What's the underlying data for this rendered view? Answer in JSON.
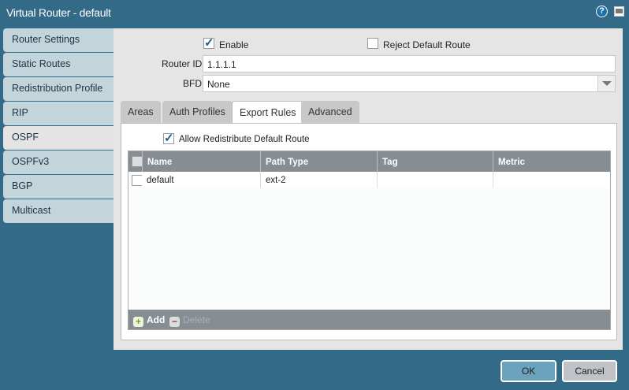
{
  "window": {
    "title": "Virtual Router - default",
    "help_icon": "?"
  },
  "sidebar": {
    "items": [
      {
        "label": "Router Settings"
      },
      {
        "label": "Static Routes"
      },
      {
        "label": "Redistribution Profile"
      },
      {
        "label": "RIP"
      },
      {
        "label": "OSPF",
        "active": true
      },
      {
        "label": "OSPFv3"
      },
      {
        "label": "BGP"
      },
      {
        "label": "Multicast"
      }
    ]
  },
  "form": {
    "enable_label": "Enable",
    "enable_checked": true,
    "reject_label": "Reject Default Route",
    "reject_checked": false,
    "router_id_label": "Router ID",
    "router_id_value": "1.1.1.1",
    "bfd_label": "BFD",
    "bfd_value": "None"
  },
  "tabs": [
    {
      "label": "Areas"
    },
    {
      "label": "Auth Profiles"
    },
    {
      "label": "Export Rules",
      "active": true
    },
    {
      "label": "Advanced"
    }
  ],
  "export": {
    "allow_label": "Allow Redistribute Default Route",
    "allow_checked": true,
    "columns": [
      "Name",
      "Path Type",
      "Tag",
      "Metric"
    ],
    "rows": [
      {
        "name": "default",
        "path_type": "ext-2",
        "tag": "",
        "metric": ""
      }
    ],
    "add_label": "Add",
    "delete_label": "Delete"
  },
  "buttons": {
    "ok": "OK",
    "cancel": "Cancel"
  },
  "colors": {
    "frame": "#326a88",
    "ok": "#6ba3bd",
    "cancel": "#c0c2c8",
    "table_header": "#868d93"
  }
}
